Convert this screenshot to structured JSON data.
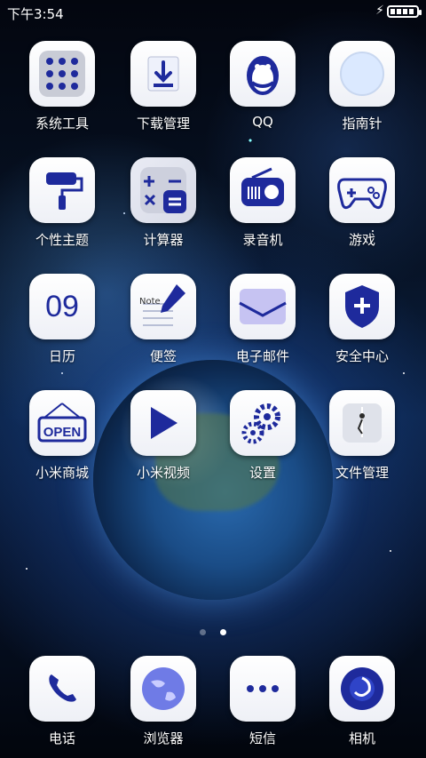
{
  "status_bar": {
    "time": "下午3:54",
    "charging_icon": "bolt-icon",
    "battery_icon": "battery-icon"
  },
  "page_indicator": {
    "pages": 2,
    "active": 2
  },
  "apps": [
    {
      "label": "系统工具",
      "icon": "tools-grid-icon"
    },
    {
      "label": "下载管理",
      "icon": "download-icon"
    },
    {
      "label": "QQ",
      "icon": "qq-penguin-icon"
    },
    {
      "label": "指南针",
      "icon": "compass-icon"
    },
    {
      "label": "个性主题",
      "icon": "paint-roller-icon"
    },
    {
      "label": "计算器",
      "icon": "calculator-icon"
    },
    {
      "label": "录音机",
      "icon": "radio-recorder-icon"
    },
    {
      "label": "游戏",
      "icon": "gamepad-icon"
    },
    {
      "label": "日历",
      "icon": "calendar-icon",
      "value": "09"
    },
    {
      "label": "便签",
      "icon": "note-icon",
      "value": "Note"
    },
    {
      "label": "电子邮件",
      "icon": "mail-icon"
    },
    {
      "label": "安全中心",
      "icon": "shield-icon"
    },
    {
      "label": "小米商城",
      "icon": "open-sign-icon",
      "value": "OPEN"
    },
    {
      "label": "小米视频",
      "icon": "play-icon"
    },
    {
      "label": "设置",
      "icon": "gears-icon"
    },
    {
      "label": "文件管理",
      "icon": "file-icon"
    }
  ],
  "dock": [
    {
      "label": "电话",
      "icon": "phone-icon"
    },
    {
      "label": "浏览器",
      "icon": "globe-icon"
    },
    {
      "label": "短信",
      "icon": "sms-icon"
    },
    {
      "label": "相机",
      "icon": "camera-icon"
    }
  ],
  "colors": {
    "accent_blue": "#1e2a9c",
    "tile": "#f4f5f9"
  }
}
